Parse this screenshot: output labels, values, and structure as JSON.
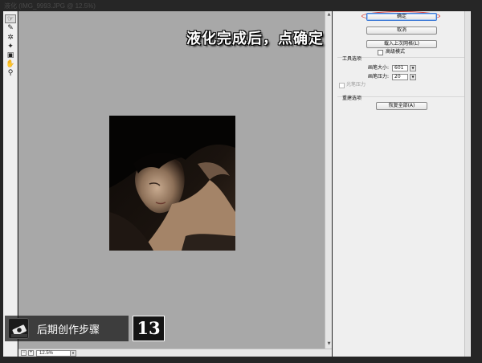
{
  "window": {
    "title": "液化 (IMG_9993.JPG @ 12.5%)"
  },
  "tools": [
    {
      "name": "forward-warp-tool",
      "glyph": "☞",
      "active": true
    },
    {
      "name": "reconstruct-tool",
      "glyph": "✎",
      "active": false
    },
    {
      "name": "pucker-tool",
      "glyph": "✲",
      "active": false
    },
    {
      "name": "bloat-tool",
      "glyph": "✦",
      "active": false
    },
    {
      "name": "freeze-mask-tool",
      "glyph": "▣",
      "active": false
    },
    {
      "name": "hand-tool",
      "glyph": "✋",
      "active": false
    },
    {
      "name": "zoom-tool",
      "glyph": "⚲",
      "active": false
    }
  ],
  "status": {
    "zoom": "12.5%"
  },
  "panel": {
    "ok_label": "确定",
    "cancel_label": "取消",
    "load_mesh_label": "载入上次网格(L)",
    "advanced_mode_label": "高级模式",
    "tool_options": {
      "title": "工具选项",
      "brush_size_label": "画笔大小:",
      "brush_size_value": "601",
      "brush_pressure_label": "画笔压力:",
      "brush_pressure_value": "20",
      "stylus_label": "光笔压力"
    },
    "reconstruct": {
      "title": "重建选项",
      "restore_all_label": "恢复全部(A)"
    }
  },
  "annotation": {
    "text": "液化完成后，点确定",
    "ring_color": "#d8332c"
  },
  "banner": {
    "title": "后期创作步骤",
    "step": "13"
  },
  "colors": {
    "canvas": "#a8a8a8",
    "panel": "#efefef",
    "default_button_border": "#3d7ad6"
  }
}
